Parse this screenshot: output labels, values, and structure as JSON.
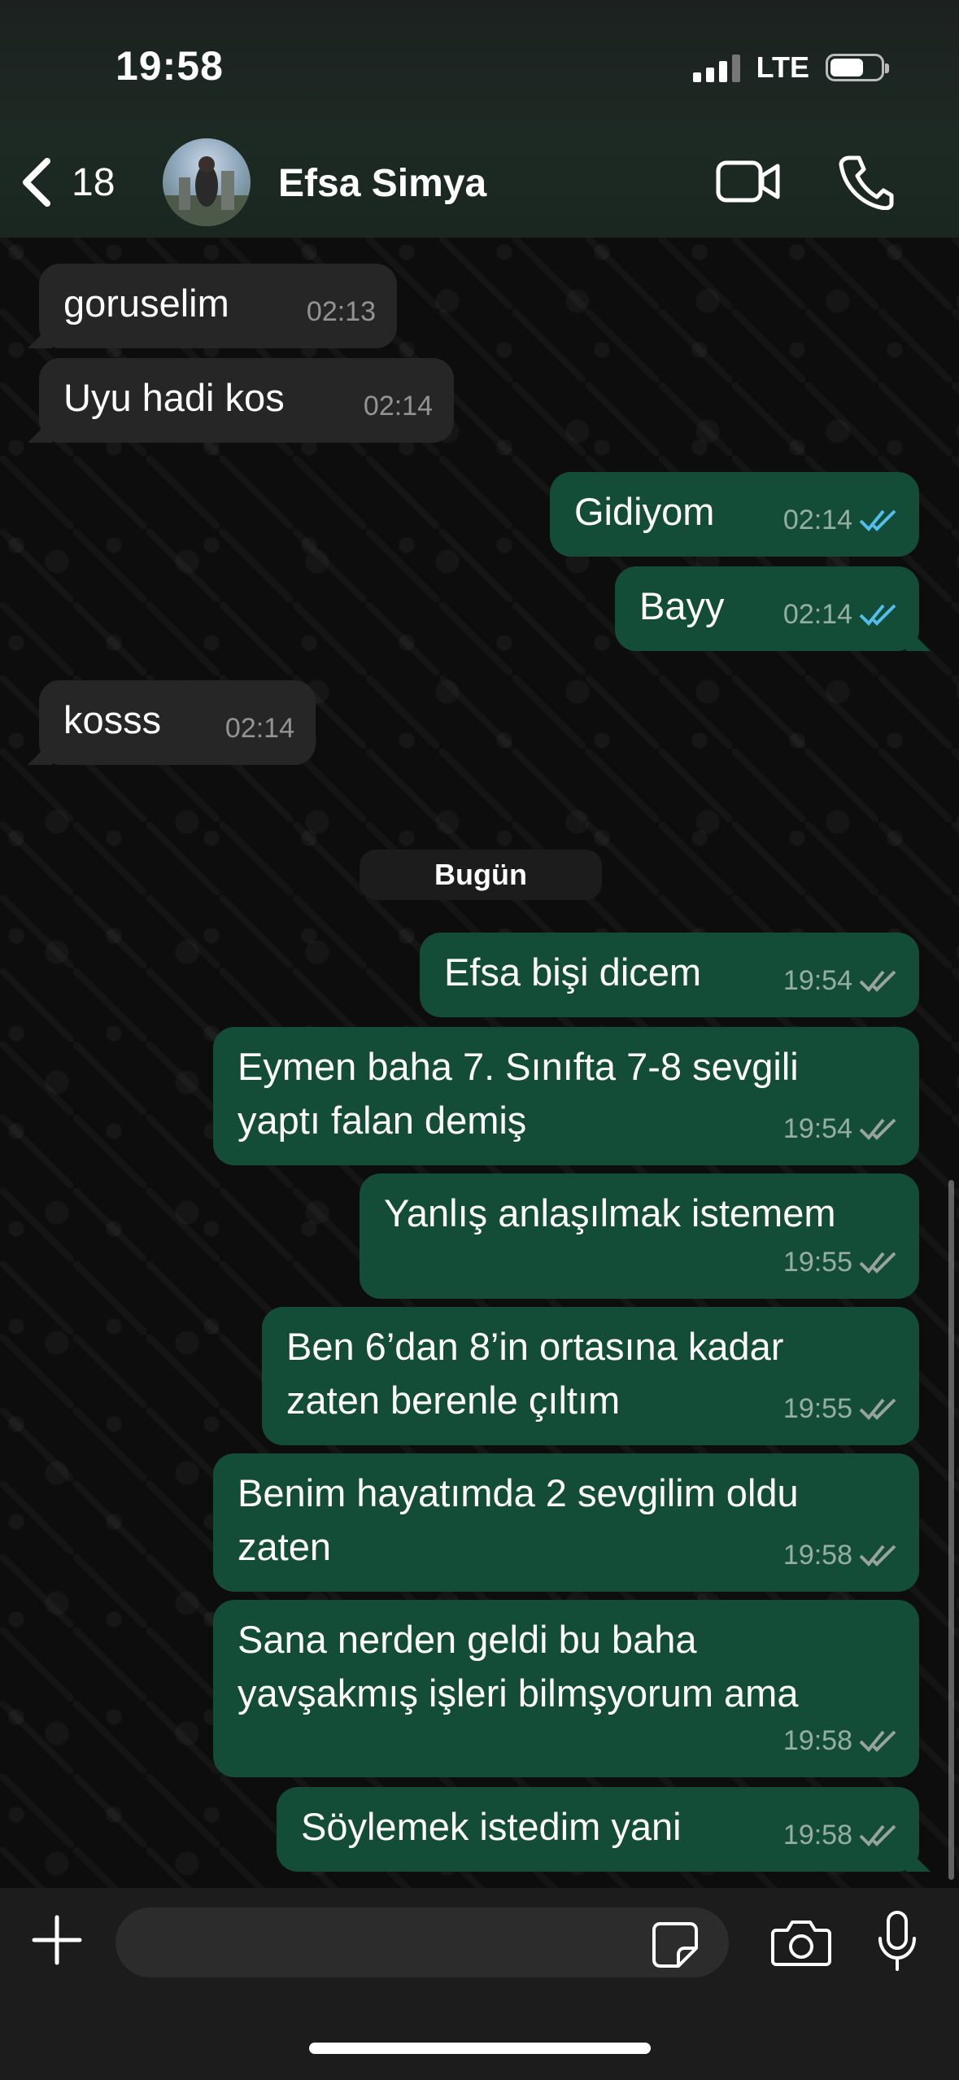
{
  "status_bar": {
    "time": "19:58",
    "network": "LTE",
    "battery_level": 0.6
  },
  "header": {
    "back_count": "18",
    "contact_name": "Efsa Simya"
  },
  "messages": [
    {
      "dir": "in",
      "text": "goruselim",
      "time": "02:13"
    },
    {
      "dir": "in",
      "text": "Uyu hadi kos",
      "time": "02:14"
    },
    {
      "dir": "out",
      "text": "Gidiyom",
      "time": "02:14",
      "read": true
    },
    {
      "dir": "out",
      "text": "Bayy",
      "time": "02:14",
      "read": true
    },
    {
      "dir": "in",
      "text": "kosss",
      "time": "02:14"
    },
    {
      "dir": "out",
      "text": "Efsa bişi dicem",
      "time": "19:54",
      "read": false
    },
    {
      "dir": "out",
      "text": "Eymen baha 7. Sınıfta 7-8 sevgili yaptı falan demiş",
      "time": "19:54",
      "read": false
    },
    {
      "dir": "out",
      "text": "Yanlış anlaşılmak istemem",
      "time": "19:55",
      "read": false
    },
    {
      "dir": "out",
      "text": "Ben 6’dan 8’in ortasına kadar zaten berenle çıltım",
      "time": "19:55",
      "read": false
    },
    {
      "dir": "out",
      "text": "Benim hayatımda 2 sevgilim oldu zaten",
      "time": "19:58",
      "read": false
    },
    {
      "dir": "out",
      "text": "Sana nerden geldi bu baha yavşakmış işleri bilmşyorum ama",
      "time": "19:58",
      "read": false
    },
    {
      "dir": "out",
      "text": "Söylemek istedim yani",
      "time": "19:58",
      "read": false
    }
  ],
  "date_separator": "Bugün",
  "colors": {
    "incoming_bubble": "#262626",
    "outgoing_bubble": "#144d37",
    "read_tick": "#53bdeb",
    "delivered_tick": "#9aa39e"
  }
}
